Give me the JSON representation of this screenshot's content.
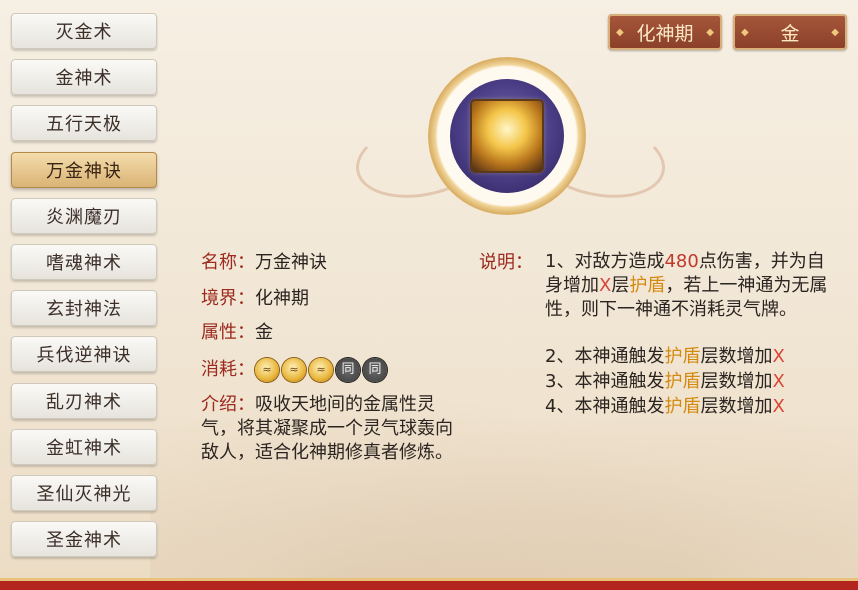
{
  "skills": [
    {
      "label": "灭金术"
    },
    {
      "label": "金神术"
    },
    {
      "label": "五行天极"
    },
    {
      "label": "万金神诀"
    },
    {
      "label": "炎渊魔刃"
    },
    {
      "label": "嗜魂神术"
    },
    {
      "label": "玄封神法"
    },
    {
      "label": "兵伐逆神诀"
    },
    {
      "label": "乱刃神术"
    },
    {
      "label": "金虹神术"
    },
    {
      "label": "圣仙灭神光"
    },
    {
      "label": "圣金神术"
    }
  ],
  "selected_skill": "万金神诀",
  "tags": {
    "realm": "化神期",
    "attribute": "金"
  },
  "info": {
    "name_label": "名称：",
    "name": "万金神诀",
    "realm_label": "境界：",
    "realm": "化神期",
    "attr_label": "属性：",
    "attr": "金",
    "cost_label": "消耗：",
    "cost_icons": [
      "gold-qi-icon",
      "gold-qi-icon",
      "gold-qi-icon",
      "tong-icon",
      "tong-icon"
    ],
    "tong_glyph": "同",
    "intro_label": "介绍：",
    "intro": "吸收天地间的金属性灵气，将其凝聚成一个灵气球轰向敌人，适合化神期修真者修炼。"
  },
  "description": {
    "label": "说明：",
    "line1_a": "1、对敌方造成",
    "damage": "480",
    "line1_b": "点伤害，并为自身增加",
    "x": "X",
    "line1_c": "层",
    "shield": "护盾",
    "line1_d": "，若上一神通为无属性，则下一神通不消耗灵气牌。",
    "line2_a": "2、本神通触发",
    "line3_a": "3、本神通触发",
    "line4_a": "4、本神通触发",
    "line_tail": "层数增加"
  },
  "colors": {
    "label": "#9c2a1f",
    "damage": "#c0392b",
    "shield": "#d48a10",
    "bottom_bar": "#b3261e"
  }
}
